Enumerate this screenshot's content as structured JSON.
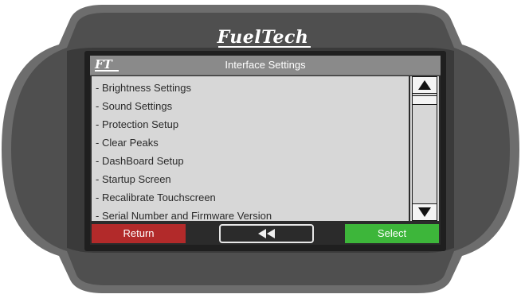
{
  "device": {
    "brand": "FuelTech"
  },
  "window": {
    "logo_text": "FT",
    "title": "Interface Settings"
  },
  "menu": {
    "items": [
      "- Brightness Settings",
      "- Sound Settings",
      "- Protection Setup",
      "- Clear Peaks",
      "- DashBoard Setup",
      "- Startup Screen",
      "- Recalibrate Touchscreen",
      "- Serial Number and Firmware Version"
    ]
  },
  "scrollbar": {
    "up_icon": "triangle-up-icon",
    "down_icon": "triangle-down-icon"
  },
  "buttons": {
    "return_label": "Return",
    "back_icon": "double-chevron-left-icon",
    "select_label": "Select"
  },
  "colors": {
    "return": "#b22a2a",
    "select": "#3db63a",
    "title_bar": "#8a8a8a",
    "list_bg": "#d7d7d7"
  }
}
